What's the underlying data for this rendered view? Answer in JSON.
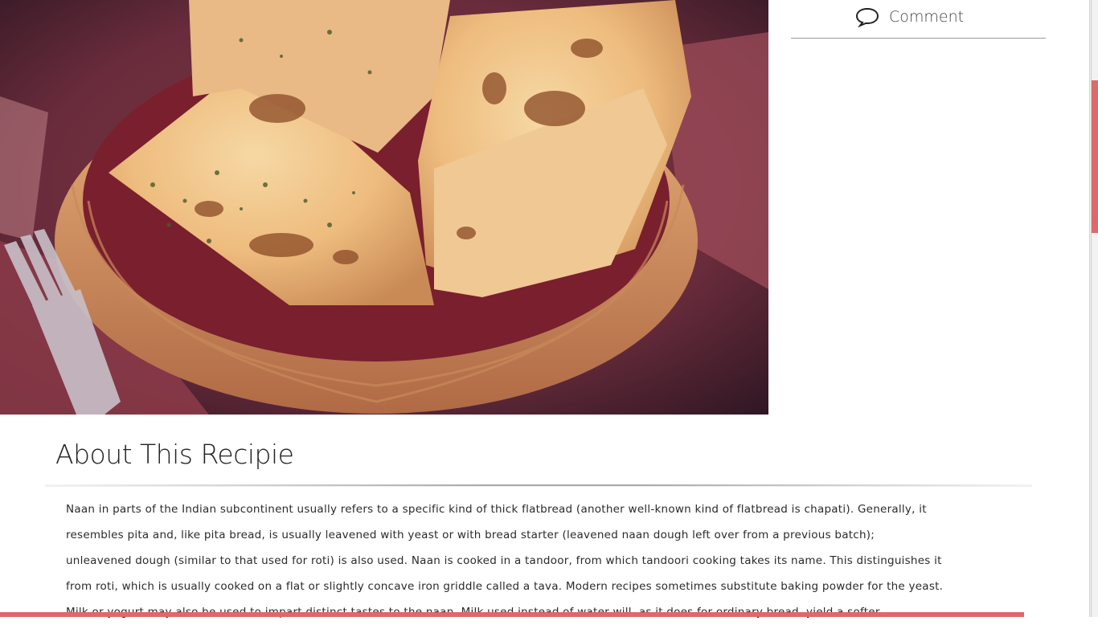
{
  "hero": {
    "image_name": "naan-bread-basket-photo"
  },
  "meta": {
    "comment_label": "Comment",
    "comment_icon": "speech-bubble-icon"
  },
  "article": {
    "heading": "About This Recipie",
    "body": "Naan in parts of the Indian subcontinent usually refers to a specific kind of thick flatbread (another well-known kind of flatbread is chapati). Generally, it resembles pita and, like pita bread, is usually leavened with yeast or with bread starter (leavened naan dough left over from a previous batch); unleavened dough (similar to that used for roti) is also used. Naan is cooked in a tandoor, from which tandoori cooking takes its name. This distinguishes it from roti, which is usually cooked on a flat or slightly concave iron griddle called a tava. Modern recipes sometimes substitute baking powder for the yeast. Milk or yogurt may also be used to impart distinct tastes to the naan. Milk used instead of water will, as it does for ordinary bread, yield a softer"
  },
  "colors": {
    "accent": "#e0676a",
    "text": "#2a2a2a",
    "rule": "#9a9a9a"
  }
}
